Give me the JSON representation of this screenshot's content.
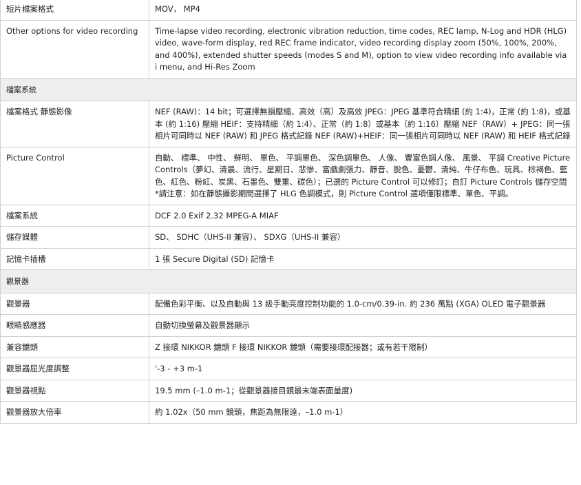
{
  "rows": [
    {
      "type": "row",
      "label": "短片檔案格式",
      "value": "MOV， MP4"
    },
    {
      "type": "row",
      "label": "Other options for video recording",
      "value": "Time-lapse video recording, electronic vibration reduction, time codes, REC lamp, N-Log and HDR (HLG) video, wave-form display, red REC frame indicator, video recording display zoom (50%, 100%, 200%, and 400%), extended shutter speeds (modes S and M), option to view video recording info available via i menu, and Hi-Res Zoom"
    },
    {
      "type": "section",
      "label": "檔案系統"
    },
    {
      "type": "row",
      "label": "檔案格式 靜態影像",
      "value": "NEF (RAW)：14 bit；可選擇無損壓縮、高效（高）及高效 JPEG：JPEG 基準符合精細 (約 1:4)，正常 (約 1:8)，或基本 (約 1:16) 壓縮 HEIF：支持精細（約 1:4）、正常（約 1:8）或基本（約 1:16）壓縮 NEF（RAW）+ JPEG：同一張相片可同時以 NEF (RAW) 和 JPEG 格式記錄 NEF (RAW)+HEIF：同一張相片可同時以 NEF (RAW) 和 HEIF 格式記錄"
    },
    {
      "type": "row",
      "label": "Picture Control",
      "value": "自動、 標準、 中性、 鮮明、 單色、 平調單色、 深色調單色、 人像、 豐富色調人像、 風景、 平調 Creative Picture Controls（夢幻、清晨、流行、星期日、悲慘、富戲劇張力、靜音、脫色、憂鬱、清純、牛仔布色、玩具、棕褐色、藍色、紅色、粉紅、炭黑、石墨色、雙重、碳色）；已選的 Picture Control 可以修訂；自訂 Picture Controls 儲存空間 *請注意：如在靜態攝影期間選擇了 HLG 色調模式，則 Picture Control 選項僅限標準、單色、平調。"
    },
    {
      "type": "row",
      "label": "檔案系統",
      "value": "DCF 2.0 Exif 2.32 MPEG-A MIAF"
    },
    {
      "type": "row",
      "label": "儲存媒體",
      "value": "SD、 SDHC（UHS-II 兼容）、 SDXG（UHS-II 兼容）"
    },
    {
      "type": "row",
      "label": "記憶卡插槽",
      "value": "1 張 Secure Digital (SD) 記憶卡"
    },
    {
      "type": "section",
      "label": "觀景器"
    },
    {
      "type": "row",
      "label": "觀景器",
      "value": "配備色彩平衡、以及自動與 13 級手動亮度控制功能的 1.0-cm/0.39-in. 約 236 萬點 (XGA) OLED 電子觀景器"
    },
    {
      "type": "row",
      "label": "眼睛感應器",
      "value": "自動切換螢幕及觀景器顯示"
    },
    {
      "type": "row",
      "label": "兼容鏡頭",
      "value": "Z 接環 NIKKOR 鏡頭 F 接環 NIKKOR 鏡頭（需要接環配接器；或有若干限制）"
    },
    {
      "type": "row",
      "label": "觀景器屈光度調整",
      "value": "'-3 - +3 m-1"
    },
    {
      "type": "row",
      "label": "觀景器視點",
      "value": "19.5 mm (–1.0 m-1；從觀景器接目鏡最末端表面量度)"
    },
    {
      "type": "row",
      "label": "觀景器放大倍率",
      "value": "約 1.02x（50 mm 鏡頭，焦距為無限遠，–1.0 m-1）"
    }
  ]
}
